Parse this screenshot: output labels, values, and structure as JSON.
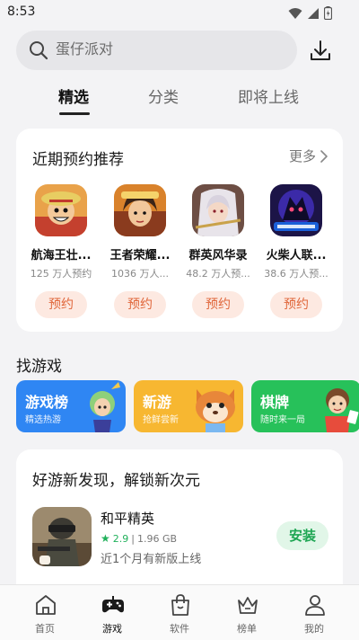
{
  "status_bar": {
    "time": "8:53"
  },
  "search": {
    "placeholder": "蛋仔派对"
  },
  "tabs": [
    {
      "label": "精选",
      "active": true
    },
    {
      "label": "分类",
      "active": false
    },
    {
      "label": "即将上线",
      "active": false
    }
  ],
  "recommend": {
    "title": "近期预约推荐",
    "more_label": "更多",
    "apps": [
      {
        "name": "航海王壮...",
        "subtitle": "125 万人预约",
        "button": "预约",
        "icon": "one-piece-game-icon"
      },
      {
        "name": "王者荣耀...",
        "subtitle": "1036 万人...",
        "button": "预约",
        "icon": "honor-of-kings-icon"
      },
      {
        "name": "群英风华录",
        "subtitle": "48.2 万人预...",
        "button": "预约",
        "icon": "heroes-game-icon"
      },
      {
        "name": "火柴人联...",
        "subtitle": "38.6 万人预...",
        "button": "预约",
        "icon": "stickman-league-icon"
      }
    ]
  },
  "find_games": {
    "title": "找游戏",
    "cards": [
      {
        "title": "游戏榜",
        "subtitle": "精选热游",
        "color": "#2f86f3"
      },
      {
        "title": "新游",
        "subtitle": "抢鲜尝新",
        "color": "#f7b731"
      },
      {
        "title": "棋牌",
        "subtitle": "随时来一局",
        "color": "#27c15a"
      }
    ]
  },
  "discover": {
    "title": "好游新发现，解锁新次元",
    "game": {
      "name": "和平精英",
      "rating": "2.9",
      "size": "1.96 GB",
      "description": "近1个月有新版上线",
      "install_label": "安装",
      "icon": "peacekeeper-elite-icon"
    }
  },
  "bottom_nav": [
    {
      "label": "首页",
      "icon": "home-icon",
      "active": false
    },
    {
      "label": "游戏",
      "icon": "gamepad-icon",
      "active": true
    },
    {
      "label": "软件",
      "icon": "shopping-bag-icon",
      "active": false
    },
    {
      "label": "榜单",
      "icon": "crown-icon",
      "active": false
    },
    {
      "label": "我的",
      "icon": "person-icon",
      "active": false
    }
  ]
}
